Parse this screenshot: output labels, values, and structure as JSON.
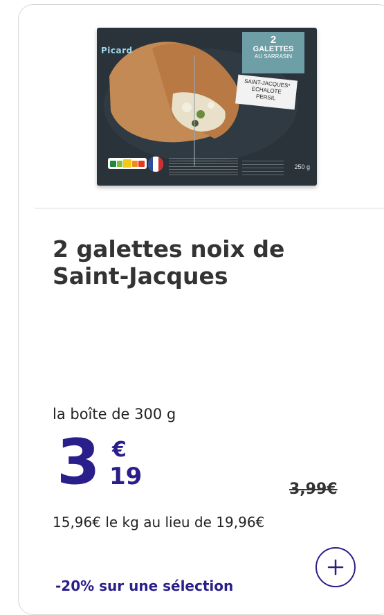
{
  "product": {
    "image": {
      "brand": "Picard",
      "badge_number": "2",
      "badge_title": "GALETTES",
      "badge_subtitle": "AU SARRASIN",
      "flavor_lines": [
        "SAINT-JACQUES*",
        "ECHALOTE",
        "PERSIL"
      ],
      "weight": "250 g"
    },
    "title": "2 galettes noix de Saint-Jacques",
    "unit_label": "la boîte de 300 g",
    "price": {
      "integer": "3",
      "currency": "€",
      "cents": "19",
      "old_price": "3,99€"
    },
    "price_per_kg": "15,96€ le kg au lieu de 19,96€",
    "promotion": "-20% sur une sélection",
    "add_button_icon": "plus-icon"
  },
  "colors": {
    "accent": "#2a1e8a",
    "box_background": "#2b333a",
    "badge_teal": "#6f9fa6",
    "border": "#d7d7d7"
  }
}
